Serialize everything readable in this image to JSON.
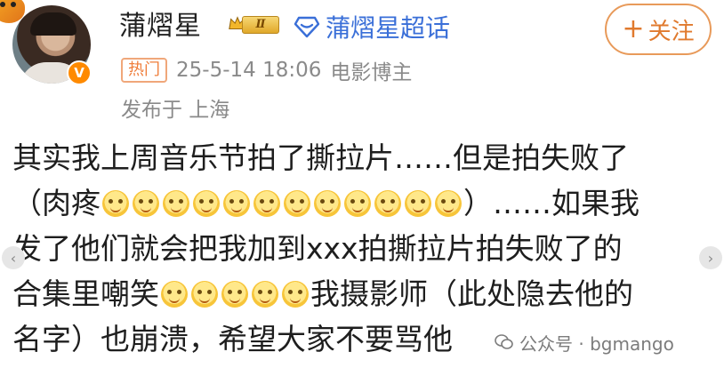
{
  "user": {
    "name": "蒲熠星",
    "verified_mark": "V",
    "level_badge": "Ⅱ",
    "supertopic": "蒲熠星超话",
    "follow_label": "关注",
    "follow_plus": "+"
  },
  "meta": {
    "hot_tag": "热门",
    "timestamp": "25-5-14 18:06",
    "role": "电影博主",
    "location": "发布于 上海"
  },
  "post": {
    "line1": "其实我上周音乐节拍了撕拉片……但是拍失败了",
    "line2_open": "（肉疼",
    "line2_close": "）……如果我",
    "line3": "发了他们就会把我加到xxx拍撕拉片拍失败了的",
    "line4_start": "合集里嘲笑",
    "line4_end": "我摄影师（此处隐去他的",
    "line5": "名字）也崩溃，希望大家不要骂他",
    "emoji_name": "smile-emoji-icon"
  },
  "nav": {
    "left": "‹",
    "right": "›"
  },
  "watermark": {
    "text": "公众号 · bgmango"
  },
  "colors": {
    "accent": "#e07a2e",
    "link": "#3a6fd8",
    "meta": "#8a8a8a"
  }
}
